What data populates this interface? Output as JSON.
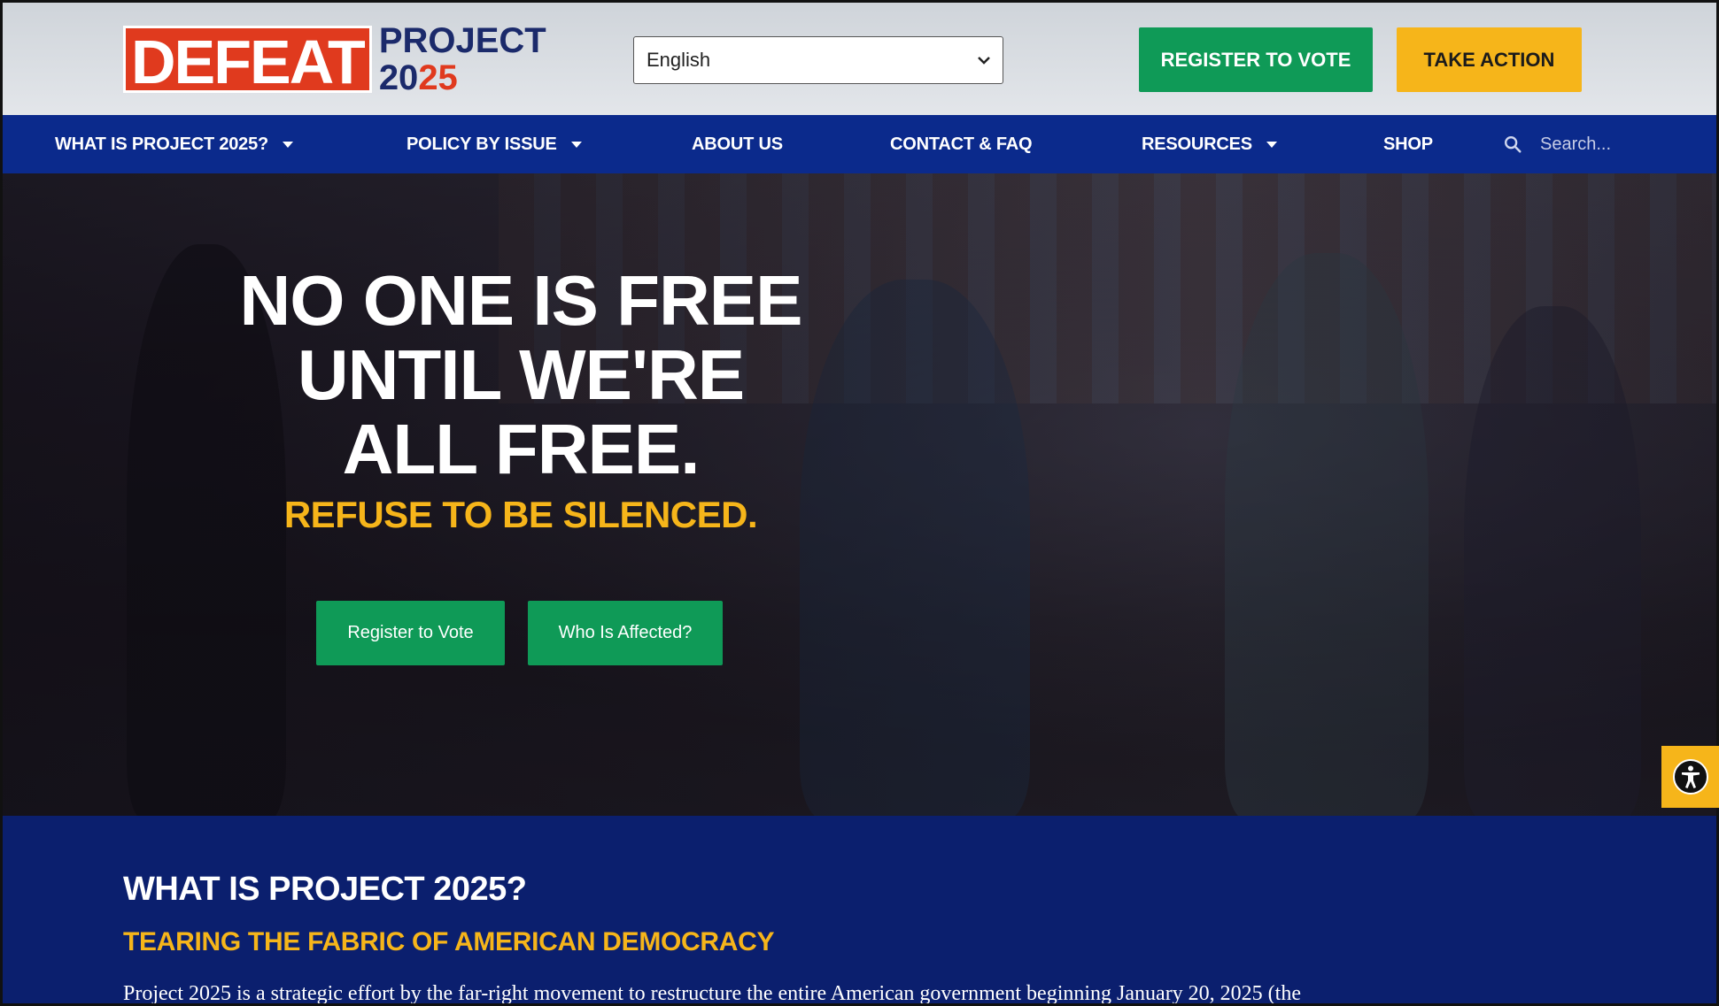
{
  "header": {
    "logo": {
      "defeat": "DEFEAT",
      "project": "PROJECT",
      "year_a": "20",
      "year_b": "25"
    },
    "language": {
      "selected": "English"
    },
    "register_label": "REGISTER TO VOTE",
    "take_action_label": "TAKE ACTION"
  },
  "nav": {
    "items": [
      {
        "label": "WHAT IS PROJECT 2025?",
        "has_dropdown": true
      },
      {
        "label": "POLICY BY ISSUE",
        "has_dropdown": true
      },
      {
        "label": "ABOUT US",
        "has_dropdown": false
      },
      {
        "label": "CONTACT & FAQ",
        "has_dropdown": false
      },
      {
        "label": "RESOURCES",
        "has_dropdown": true
      },
      {
        "label": "SHOP",
        "has_dropdown": false
      }
    ],
    "search_placeholder": "Search..."
  },
  "hero": {
    "headline_lines": [
      "NO ONE IS FREE",
      "UNTIL WE'RE",
      "ALL FREE."
    ],
    "subheadline": "REFUSE TO BE SILENCED.",
    "buttons": [
      "Register to Vote",
      "Who Is Affected?"
    ]
  },
  "about": {
    "title": "WHAT IS PROJECT 2025?",
    "subtitle": "TEARING THE FABRIC OF AMERICAN DEMOCRACY",
    "body": "Project 2025 is a strategic effort by the far-right movement to restructure the entire American government beginning January 20, 2025 (the"
  },
  "colors": {
    "brand_red": "#e03a1e",
    "brand_navy": "#0b2a8c",
    "action_green": "#0f9a57",
    "accent_gold": "#f6b51a"
  },
  "icons": {
    "search": "search-icon",
    "accessibility": "accessibility-icon",
    "dropdown": "chevron-down-icon"
  }
}
